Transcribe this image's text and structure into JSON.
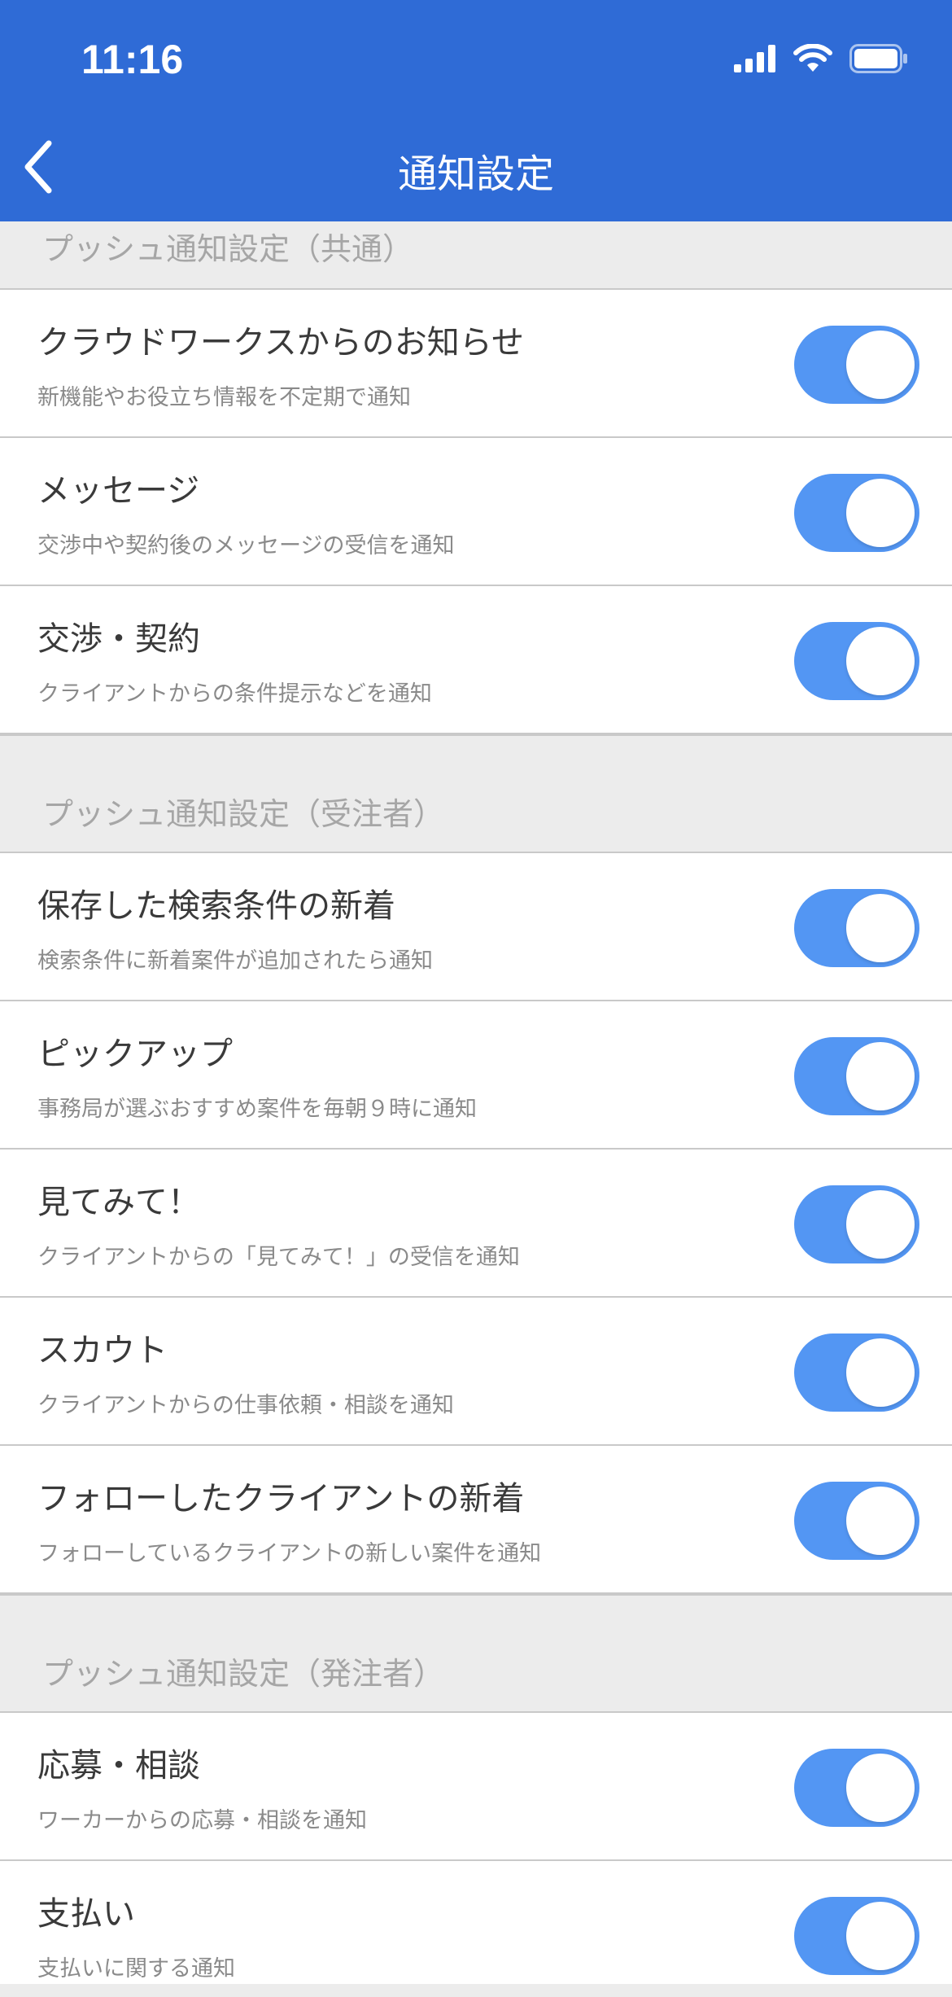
{
  "status_bar": {
    "time": "11:16"
  },
  "nav": {
    "title": "通知設定"
  },
  "colors": {
    "header": "#2f6bd6",
    "toggle_on": "#5396f3",
    "background": "#ececec"
  },
  "sections": [
    {
      "label": "プッシュ通知設定（共通）",
      "items": [
        {
          "title": "クラウドワークスからのお知らせ",
          "subtitle": "新機能やお役立ち情報を不定期で通知",
          "enabled": true
        },
        {
          "title": "メッセージ",
          "subtitle": "交渉中や契約後のメッセージの受信を通知",
          "enabled": true
        },
        {
          "title": "交渉・契約",
          "subtitle": "クライアントからの条件提示などを通知",
          "enabled": true
        }
      ]
    },
    {
      "label": "プッシュ通知設定（受注者）",
      "items": [
        {
          "title": "保存した検索条件の新着",
          "subtitle": "検索条件に新着案件が追加されたら通知",
          "enabled": true
        },
        {
          "title": "ピックアップ",
          "subtitle": "事務局が選ぶおすすめ案件を毎朝９時に通知",
          "enabled": true
        },
        {
          "title": "見てみて！",
          "subtitle": "クライアントからの「見てみて！」の受信を通知",
          "enabled": true
        },
        {
          "title": "スカウト",
          "subtitle": "クライアントからの仕事依頼・相談を通知",
          "enabled": true
        },
        {
          "title": "フォローしたクライアントの新着",
          "subtitle": "フォローしているクライアントの新しい案件を通知",
          "enabled": true
        }
      ]
    },
    {
      "label": "プッシュ通知設定（発注者）",
      "items": [
        {
          "title": "応募・相談",
          "subtitle": "ワーカーからの応募・相談を通知",
          "enabled": true
        },
        {
          "title": "支払い",
          "subtitle": "支払いに関する通知",
          "enabled": true
        }
      ]
    }
  ]
}
